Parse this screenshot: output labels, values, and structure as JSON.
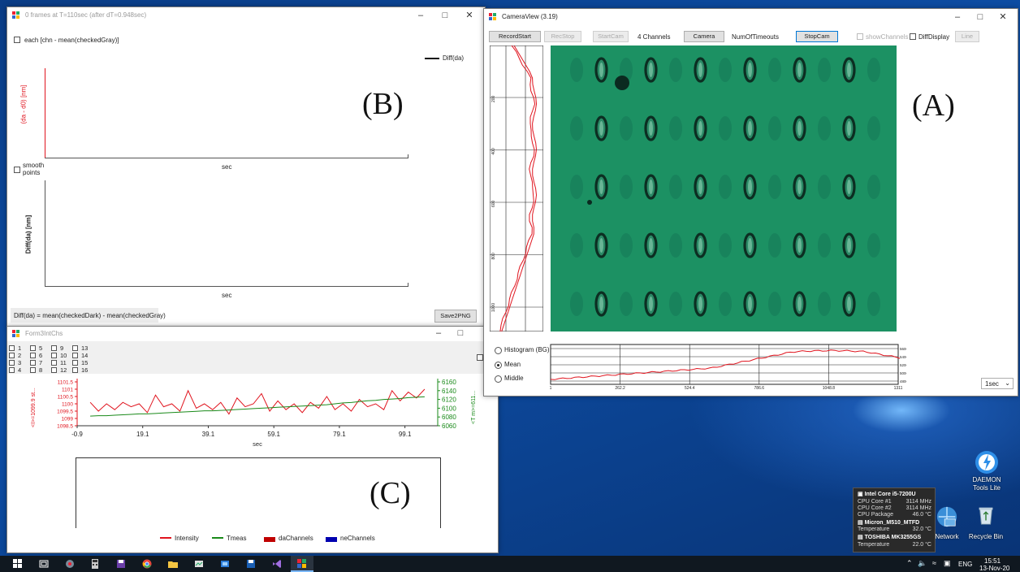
{
  "windowB": {
    "title": "0 frames at T=110sec  (after dT=0.948sec)",
    "chk_each": "each [chn - mean(checkedGray)]",
    "legend": "Diff(da)",
    "ylabel_top": "(da - d0) [nm]",
    "xlabel_top": "sec",
    "chk_smooth": "smooth points",
    "ylabel_bottom": "Diff(da) [nm]",
    "xlabel_bottom": "sec",
    "status_formula": "Diff(da) = mean(checkedDark) - mean(checkedGray)",
    "save_button": "Save2PNG",
    "panel_letter": "(B)"
  },
  "windowA": {
    "title": "CameraView (3.19)",
    "buttons": {
      "record_start": "RecordStart",
      "rec_stop": "RecStop",
      "start_cam": "StartCam",
      "channels": "4 Channels",
      "camera": "Camera",
      "num_timeouts": "NumOfTimeouts",
      "stop_cam": "StopCam",
      "show_channels": "showChannels",
      "diff_display": "DiffDisplay",
      "line": "Line"
    },
    "radios": {
      "histogram": "Histogram (BG)",
      "mean": "Mean",
      "middle": "Middle"
    },
    "interval_select": "1sec",
    "panel_letter": "(A)",
    "profile_ticks": [
      "200",
      "400",
      "600",
      "800",
      "1000"
    ],
    "mean_xticks": [
      "1",
      "262.2",
      "524.4",
      "786.6",
      "1048.8",
      "1311"
    ],
    "mean_yticks": [
      "5600",
      "5400",
      "5200",
      "5000",
      "4800"
    ],
    "colors": {
      "sample": "#1f9a6a",
      "trace": "#e0141e"
    }
  },
  "windowC": {
    "title": "Form3IntChs",
    "channels": [
      "1",
      "5",
      "9",
      "13",
      "2",
      "6",
      "10",
      "14",
      "3",
      "7",
      "11",
      "15",
      "4",
      "8",
      "12",
      "16"
    ],
    "xlabel": "sec",
    "ylabel_left": "<I>=1099.9 st...",
    "ylabel_right": "<T m>=611...",
    "legend": [
      "Intensity",
      "Tmeas",
      "daChannels",
      "neChannels"
    ],
    "legend_colors": [
      "#e0141e",
      "#1a8a1a",
      "#c00000",
      "#0000b0"
    ],
    "panel_letter": "(C)"
  },
  "chart_data": {
    "type": "line",
    "x": [
      -0.9,
      19.1,
      39.1,
      59.1,
      79.1,
      99.1
    ],
    "xlabel": "sec",
    "ylim_left": [
      1098.5,
      1101.5
    ],
    "ylim_right": [
      6060,
      6160
    ],
    "yticks_left": [
      "1101.5",
      "1101",
      "1100.5",
      "1100",
      "1099.5",
      "1099",
      "1098.5"
    ],
    "yticks_right": [
      "6160",
      "6140",
      "6120",
      "6100",
      "6080",
      "6060"
    ],
    "series": [
      {
        "name": "Intensity",
        "axis": "left",
        "values": [
          1100.1,
          1099.5,
          1100.0,
          1099.6,
          1100.1,
          1099.8,
          1100.0,
          1099.4,
          1100.6,
          1099.8,
          1100.0,
          1099.5,
          1100.9,
          1099.7,
          1100.0,
          1099.6,
          1100.1,
          1099.3,
          1100.4,
          1099.8,
          1100.0,
          1100.7,
          1099.5,
          1100.2,
          1099.6,
          1100.0,
          1099.4,
          1100.1,
          1099.7,
          1100.5,
          1099.6,
          1100.0,
          1099.5,
          1100.3,
          1099.8,
          1100.0,
          1099.6,
          1100.9,
          1100.2,
          1100.8,
          1100.4,
          1101.0
        ]
      },
      {
        "name": "Tmeas",
        "axis": "right",
        "values": [
          6082,
          6083,
          6083,
          6084,
          6085,
          6086,
          6087,
          6087,
          6088,
          6089,
          6090,
          6091,
          6092,
          6093,
          6094,
          6094,
          6095,
          6096,
          6097,
          6098,
          6099,
          6100,
          6101,
          6102,
          6103,
          6104,
          6105,
          6106,
          6107,
          6108,
          6110,
          6112,
          6113,
          6115,
          6117,
          6118,
          6120,
          6121,
          6122,
          6124,
          6125,
          6126
        ]
      }
    ]
  },
  "desktop": {
    "daemon_label": "DAEMON Tools Lite",
    "network_label": "Network",
    "recycle_label": "Recycle Bin"
  },
  "hwmonitor": {
    "cpu_title": "Intel Core i5-7200U",
    "rows": [
      {
        "k": "CPU Core #1",
        "v": "3114 MHz"
      },
      {
        "k": "CPU Core #2",
        "v": "3114 MHz"
      },
      {
        "k": "CPU Package",
        "v": "46.0 °C"
      }
    ],
    "disk1_title": "Micron_M510_MTFD",
    "disk1_temp_k": "Temperature",
    "disk1_temp_v": "32.0 °C",
    "disk2_title": "TOSHIBA MK3255GS",
    "disk2_temp_k": "Temperature",
    "disk2_temp_v": "22.0 °C"
  },
  "taskbar": {
    "lang": "ENG",
    "time": "15:51",
    "date": "13-Nov-20"
  }
}
